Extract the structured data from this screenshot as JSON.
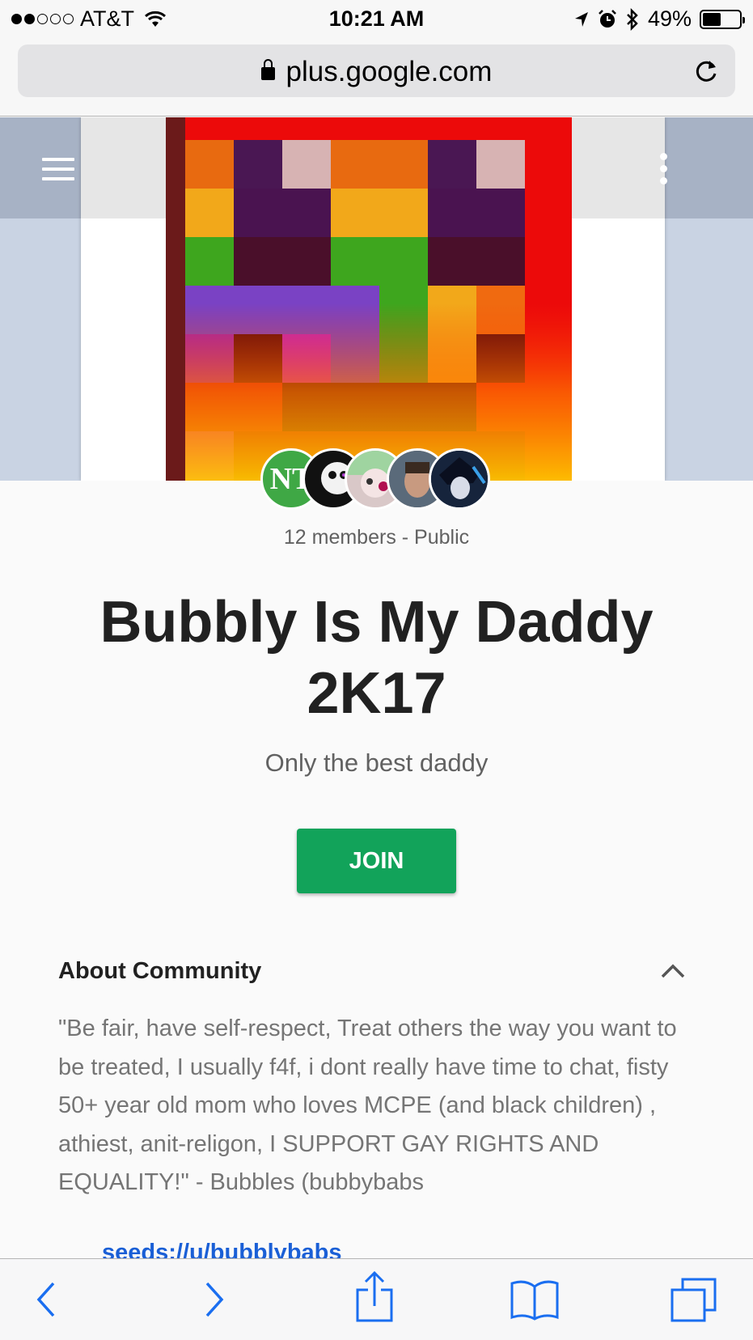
{
  "status_bar": {
    "carrier": "AT&T",
    "time": "10:21 AM",
    "battery": "49%",
    "battery_level": 0.49
  },
  "browser": {
    "url": "plus.google.com"
  },
  "community": {
    "members_info": "12 members - Public",
    "title": "Bubbly Is My Daddy 2K17",
    "tagline": "Only the best daddy",
    "join_label": "JOIN",
    "avatar_initials": "NT"
  },
  "about": {
    "heading": "About Community",
    "text": "\"Be fair, have self-respect, Treat others the way you want to be treated, I usually f4f, i dont really have time to chat, fisty 50+ year old mom who loves MCPE (and black children) , athiest, anit-religon, I SUPPORT GAY RIGHTS AND EQUALITY!\" - Bubbles (bubbybabs",
    "link": "seeds://u/bubblybabs"
  },
  "colors": {
    "join_button": "#12a35a",
    "link": "#1a5fd6"
  }
}
